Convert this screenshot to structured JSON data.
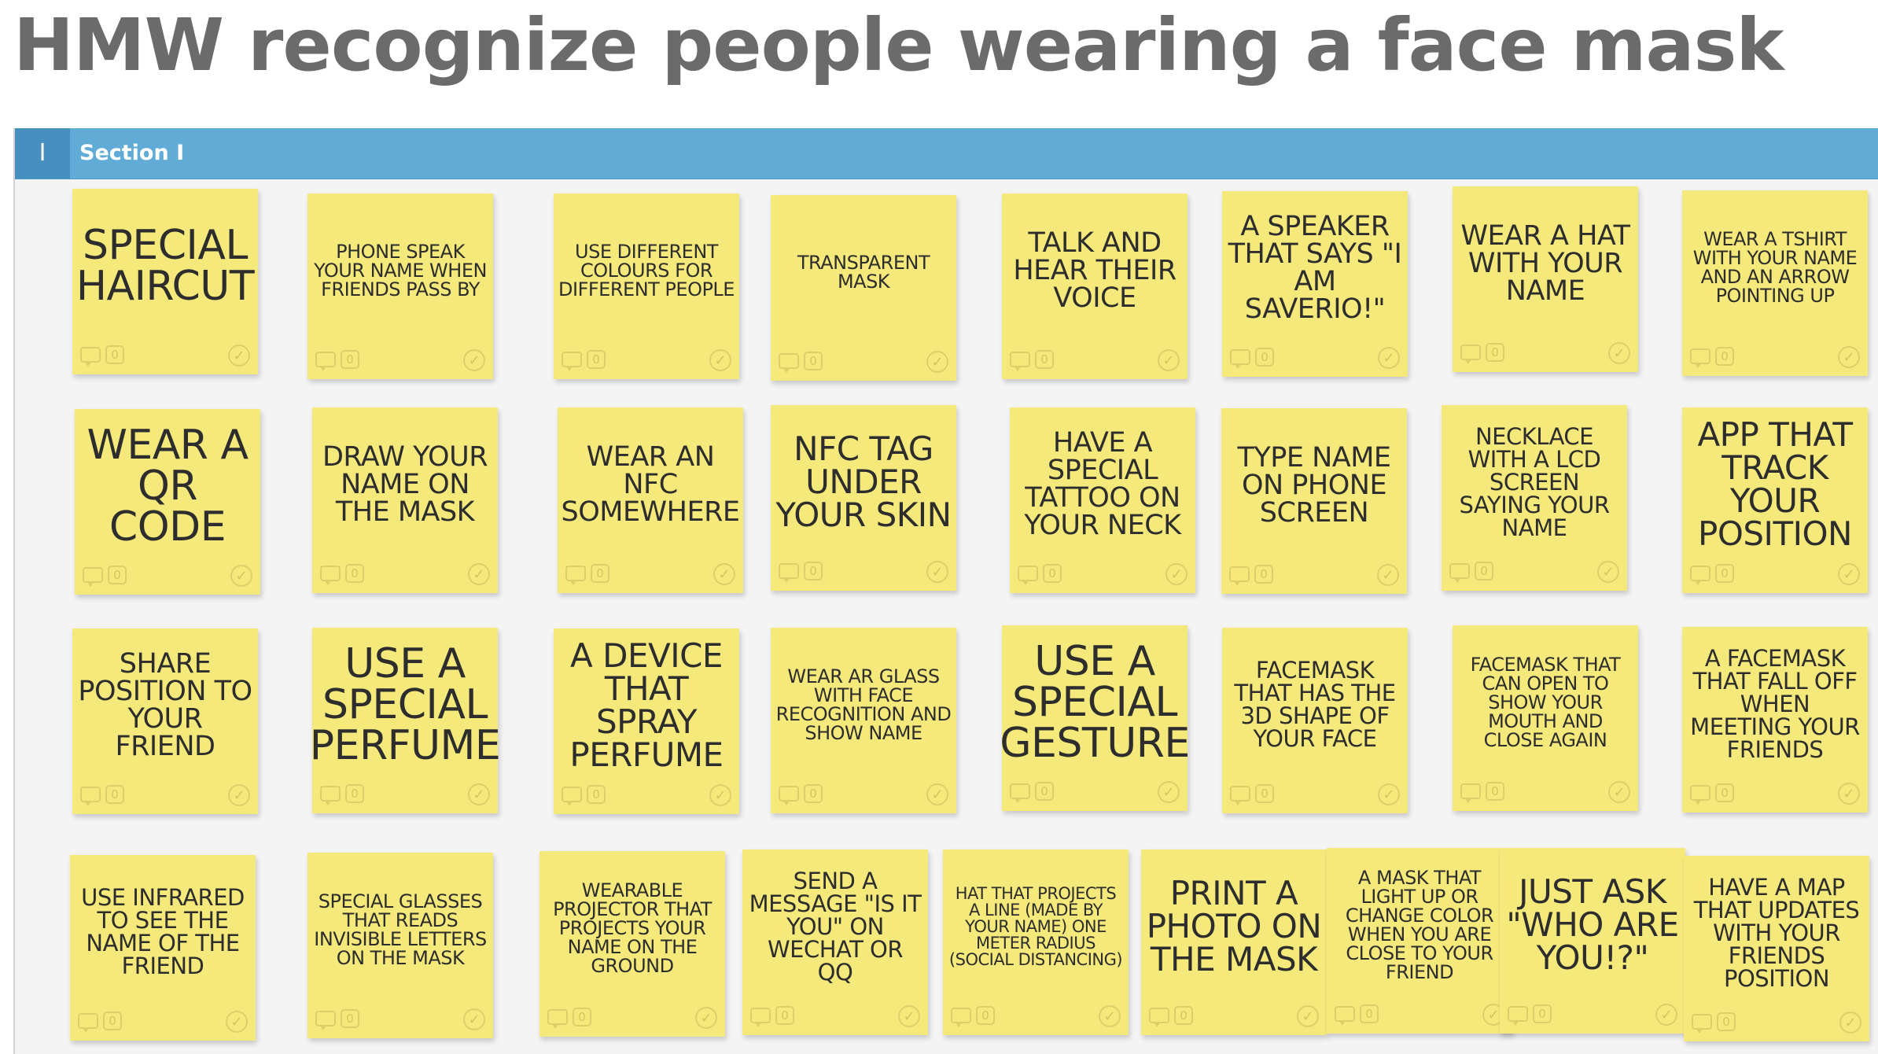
{
  "title": "HMW recognize people wearing a face mask",
  "section": {
    "badge": "I",
    "title": "Section I"
  },
  "notes": [
    {
      "text": "SPECIAL HAIRCUT",
      "comments": "0"
    },
    {
      "text": "PHONE SPEAK YOUR NAME WHEN FRIENDS PASS BY",
      "comments": "0"
    },
    {
      "text": "USE DIFFERENT COLOURS FOR DIFFERENT PEOPLE",
      "comments": "0"
    },
    {
      "text": "TRANSPARENT MASK",
      "comments": "0"
    },
    {
      "text": "TALK AND HEAR THEIR VOICE",
      "comments": "0"
    },
    {
      "text": "A SPEAKER THAT SAYS \"I AM SAVERIO!\"",
      "comments": "0"
    },
    {
      "text": "WEAR A HAT WITH YOUR NAME",
      "comments": "0"
    },
    {
      "text": "WEAR A TSHIRT WITH YOUR NAME AND AN ARROW POINTING UP",
      "comments": "0"
    },
    {
      "text": "WEAR A QR CODE",
      "comments": "0"
    },
    {
      "text": "DRAW YOUR NAME ON THE MASK",
      "comments": "0"
    },
    {
      "text": "WEAR AN NFC SOMEWHERE",
      "comments": "0"
    },
    {
      "text": "NFC TAG UNDER YOUR SKIN",
      "comments": "0"
    },
    {
      "text": "HAVE A SPECIAL TATTOO ON YOUR NECK",
      "comments": "0"
    },
    {
      "text": "TYPE NAME ON PHONE SCREEN",
      "comments": "0"
    },
    {
      "text": "NECKLACE WITH A LCD SCREEN SAYING YOUR NAME",
      "comments": "0"
    },
    {
      "text": "APP THAT TRACK YOUR POSITION",
      "comments": "0"
    },
    {
      "text": "SHARE POSITION TO YOUR FRIEND",
      "comments": "0"
    },
    {
      "text": "USE A SPECIAL PERFUME",
      "comments": "0"
    },
    {
      "text": "A DEVICE THAT SPRAY PERFUME",
      "comments": "0"
    },
    {
      "text": "WEAR AR GLASS WITH FACE RECOGNITION AND SHOW NAME",
      "comments": "0"
    },
    {
      "text": "USE A SPECIAL GESTURE",
      "comments": "0"
    },
    {
      "text": "FACEMASK THAT HAS THE 3D SHAPE OF YOUR FACE",
      "comments": "0"
    },
    {
      "text": "FACEMASK THAT CAN OPEN TO SHOW YOUR MOUTH AND CLOSE AGAIN",
      "comments": "0"
    },
    {
      "text": "A FACEMASK THAT FALL OFF WHEN MEETING YOUR FRIENDS",
      "comments": "0"
    },
    {
      "text": "USE INFRARED TO SEE THE NAME OF THE FRIEND",
      "comments": "0"
    },
    {
      "text": "SPECIAL GLASSES THAT READS INVISIBLE LETTERS ON THE MASK",
      "comments": "0"
    },
    {
      "text": "WEARABLE PROJECTOR THAT PROJECTS YOUR NAME ON THE GROUND",
      "comments": "0"
    },
    {
      "text": "SEND A MESSAGE \"IS IT YOU\" ON WECHAT OR QQ",
      "comments": "0"
    },
    {
      "text": "HAT THAT PROJECTS A LINE (MADE BY YOUR NAME) ONE METER RADIUS (SOCIAL DISTANCING)",
      "comments": "0"
    },
    {
      "text": "PRINT A PHOTO ON THE MASK",
      "comments": "0"
    },
    {
      "text": "A MASK THAT LIGHT UP OR CHANGE COLOR WHEN YOU ARE CLOSE TO YOUR FRIEND",
      "comments": "0"
    },
    {
      "text": "JUST ASK \"WHO ARE YOU!?\"",
      "comments": "0"
    },
    {
      "text": "HAVE A MAP THAT UPDATES WITH YOUR FRIENDS POSITION",
      "comments": "0"
    }
  ]
}
